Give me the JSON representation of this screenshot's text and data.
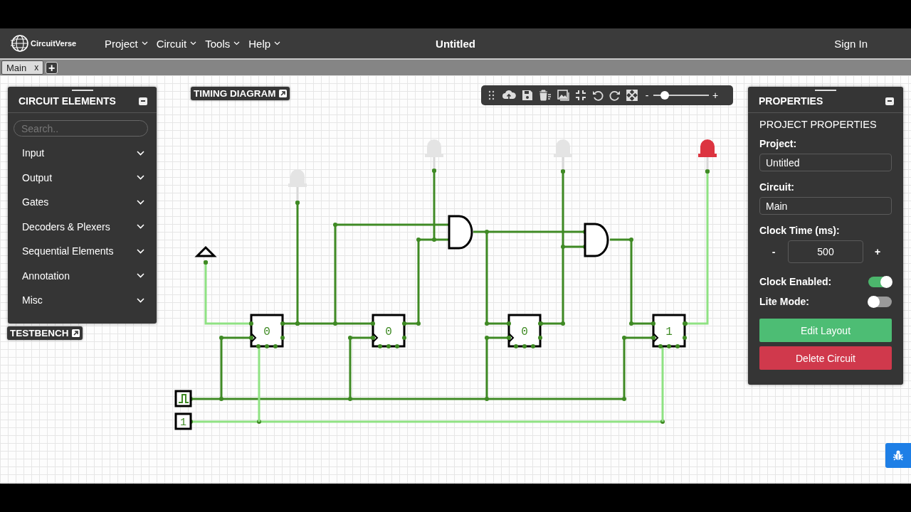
{
  "navbar": {
    "brand": "CircuitVerse",
    "menus": [
      "Project",
      "Circuit",
      "Tools",
      "Help"
    ],
    "title": "Untitled",
    "sign_in": "Sign In"
  },
  "circuit_tabs": [
    {
      "label": "Main",
      "close": "x",
      "selected": true
    }
  ],
  "add_tab": "+",
  "elements_panel": {
    "title": "CIRCUIT ELEMENTS",
    "search": {
      "placeholder": "Search.."
    },
    "categories": [
      {
        "label": "Input",
        "expanded": false
      },
      {
        "label": "Output",
        "expanded": false
      },
      {
        "label": "Gates",
        "expanded": false
      },
      {
        "label": "Decoders & Plexers",
        "expanded": false
      },
      {
        "label": "Sequential Elements",
        "expanded": false
      },
      {
        "label": "Annotation",
        "expanded": false
      },
      {
        "label": "Misc",
        "expanded": false
      }
    ]
  },
  "testbench": "TESTBENCH",
  "timing_diagram": "TIMING DIAGRAM",
  "toolbar": {
    "zoom_out": "-",
    "zoom_in": "+",
    "zoom": {
      "level": 0.2
    }
  },
  "properties": {
    "title": "PROPERTIES",
    "section": "PROJECT PROPERTIES",
    "fields": [
      {
        "label": "Project:",
        "value": "Untitled"
      },
      {
        "label": "Circuit:",
        "value": "Main"
      }
    ],
    "clock_time": {
      "label": "Clock Time (ms):",
      "minus": "-",
      "value": "500",
      "plus": "+"
    },
    "toggles": [
      {
        "label": "Clock Enabled:",
        "on": true
      },
      {
        "label": "Lite Mode:",
        "on": false
      }
    ],
    "buttons": [
      {
        "label": "Edit Layout",
        "kind": "primary"
      },
      {
        "label": "Delete Circuit",
        "kind": "danger"
      }
    ]
  },
  "circuit": {
    "flip_flops": [
      {
        "value": "0"
      },
      {
        "value": "0"
      },
      {
        "value": "0"
      },
      {
        "value": "1"
      }
    ],
    "leds": [
      {
        "on": false
      },
      {
        "on": false
      },
      {
        "on": false
      },
      {
        "on": true
      }
    ],
    "constant": "1"
  }
}
